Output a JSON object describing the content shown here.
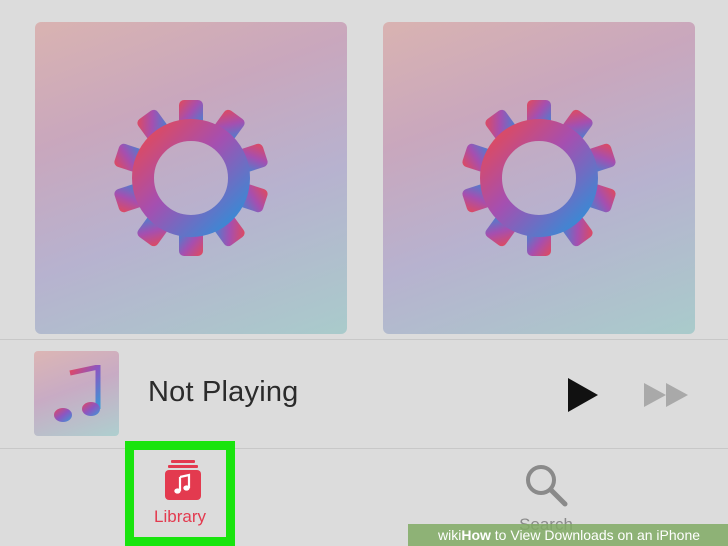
{
  "albums": [
    {
      "icon": "gear-icon"
    },
    {
      "icon": "gear-icon"
    }
  ],
  "mini_player": {
    "artwork_icon": "music-note-icon",
    "title": "Not Playing",
    "play_icon": "play-icon",
    "forward_icon": "fast-forward-icon"
  },
  "tabbar": {
    "library": {
      "label": "Library",
      "icon": "library-icon",
      "highlight_color": "#19e40e",
      "color": "#e33a4f"
    },
    "search": {
      "label": "Search",
      "icon": "search-icon"
    }
  },
  "watermark": {
    "prefix": "wiki",
    "bold": "How",
    "text": " to View Downloads on an iPhone"
  }
}
